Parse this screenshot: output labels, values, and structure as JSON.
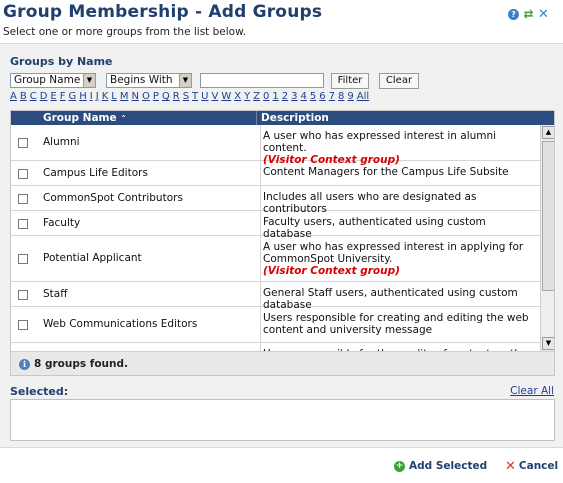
{
  "header": {
    "title": "Group Membership - Add Groups",
    "subtitle": "Select one or more groups from the list below."
  },
  "filter": {
    "section_label": "Groups by Name",
    "field_select": "Group Name",
    "match_select": "Begins With",
    "search_value": "",
    "filter_label": "Filter",
    "clear_label": "Clear",
    "alphabet": [
      "A",
      "B",
      "C",
      "D",
      "E",
      "F",
      "G",
      "H",
      "I",
      "J",
      "K",
      "L",
      "M",
      "N",
      "O",
      "P",
      "Q",
      "R",
      "S",
      "T",
      "U",
      "V",
      "W",
      "X",
      "Y",
      "Z",
      "0",
      "1",
      "2",
      "3",
      "4",
      "5",
      "6",
      "7",
      "8",
      "9",
      "All"
    ]
  },
  "table": {
    "col_name": "Group Name",
    "col_desc": "Description",
    "rows": [
      {
        "name": "Alumni",
        "desc": "A user who has expressed interest in alumni content.",
        "tag": "(Visitor Context group)"
      },
      {
        "name": "Campus Life Editors",
        "desc": "Content Managers for the Campus Life Subsite",
        "tag": ""
      },
      {
        "name": "CommonSpot Contributors",
        "desc": "Includes all users who are designated as contributors",
        "tag": ""
      },
      {
        "name": "Faculty",
        "desc": "Faculty users, authenticated using custom database",
        "tag": ""
      },
      {
        "name": "Potential Applicant",
        "desc": "A user who has expressed interest in applying for CommonSpot University.",
        "tag": "(Visitor Context group)"
      },
      {
        "name": "Staff",
        "desc": "General Staff users, authenticated using custom database",
        "tag": ""
      },
      {
        "name": "Web Communications Editors",
        "desc": "Users responsible for creating and editing the web content and university message",
        "tag": ""
      },
      {
        "name": "",
        "desc": "Users responsible for the quality of content on the site",
        "tag": ""
      }
    ],
    "found_text": "8 groups found."
  },
  "selected": {
    "label": "Selected:",
    "clear_all": "Clear All"
  },
  "footer": {
    "add_label": "Add Selected",
    "cancel_label": "Cancel"
  }
}
